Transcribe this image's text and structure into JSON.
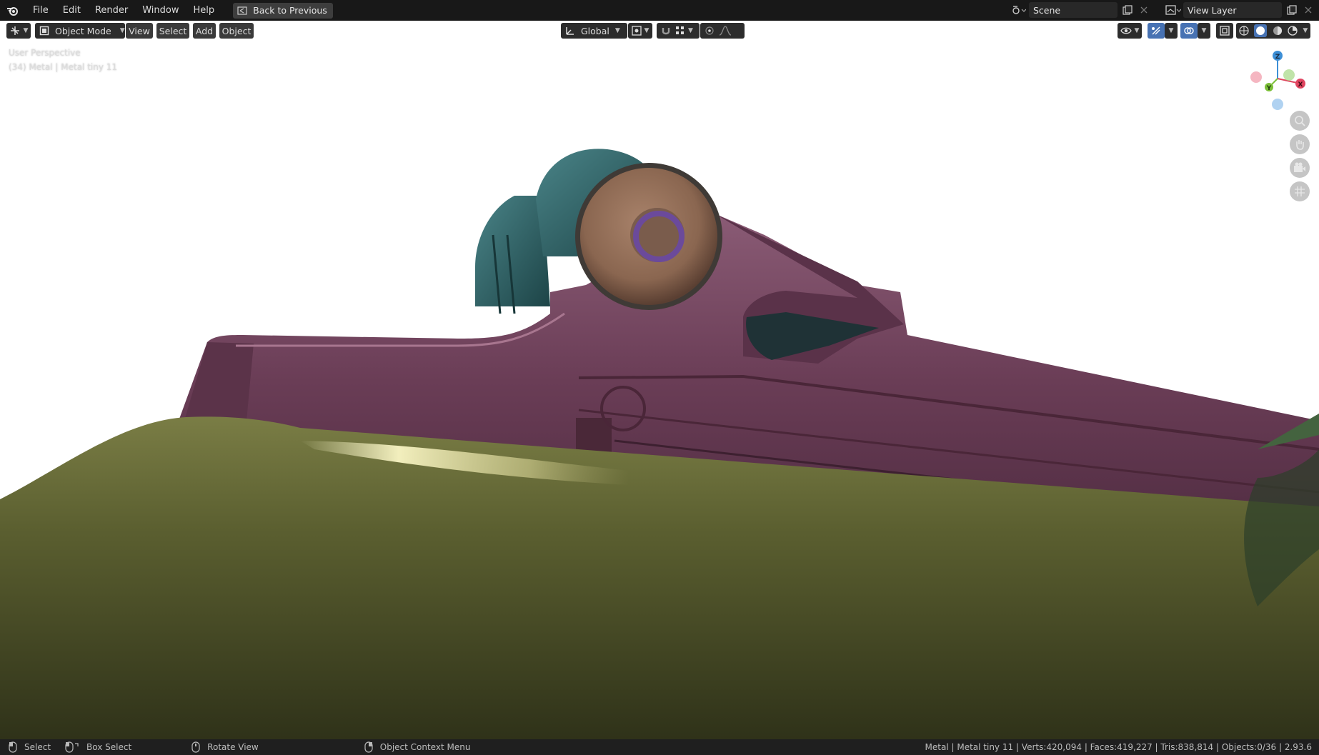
{
  "menu": {
    "items": [
      "File",
      "Edit",
      "Render",
      "Window",
      "Help"
    ],
    "back_label": "Back to Previous"
  },
  "scene": {
    "value": "Scene"
  },
  "view_layer": {
    "value": "View Layer"
  },
  "header": {
    "mode": "Object Mode",
    "view": "View",
    "select": "Select",
    "add": "Add",
    "object": "Object",
    "transform_orientation": "Global"
  },
  "viewport": {
    "perspective": "User Perspective",
    "object_info": "(34) Metal | Metal tiny 11"
  },
  "gizmo": {
    "z": "Z",
    "y": "Y",
    "x": "X"
  },
  "status": {
    "select": "Select",
    "box_select": "Box Select",
    "rotate": "Rotate View",
    "context": "Object Context Menu",
    "stats": "Metal  | Metal tiny 11 | Verts:420,094 | Faces:419,227 | Tris:838,814 | Objects:0/36 | 2.93.6"
  },
  "colors": {
    "accent": "#4772b3",
    "metal_purple": "#6b3a55",
    "stock_green": "#5a5f2c",
    "knob_bronze": "#8a6650",
    "teal": "#2a5a5e"
  }
}
